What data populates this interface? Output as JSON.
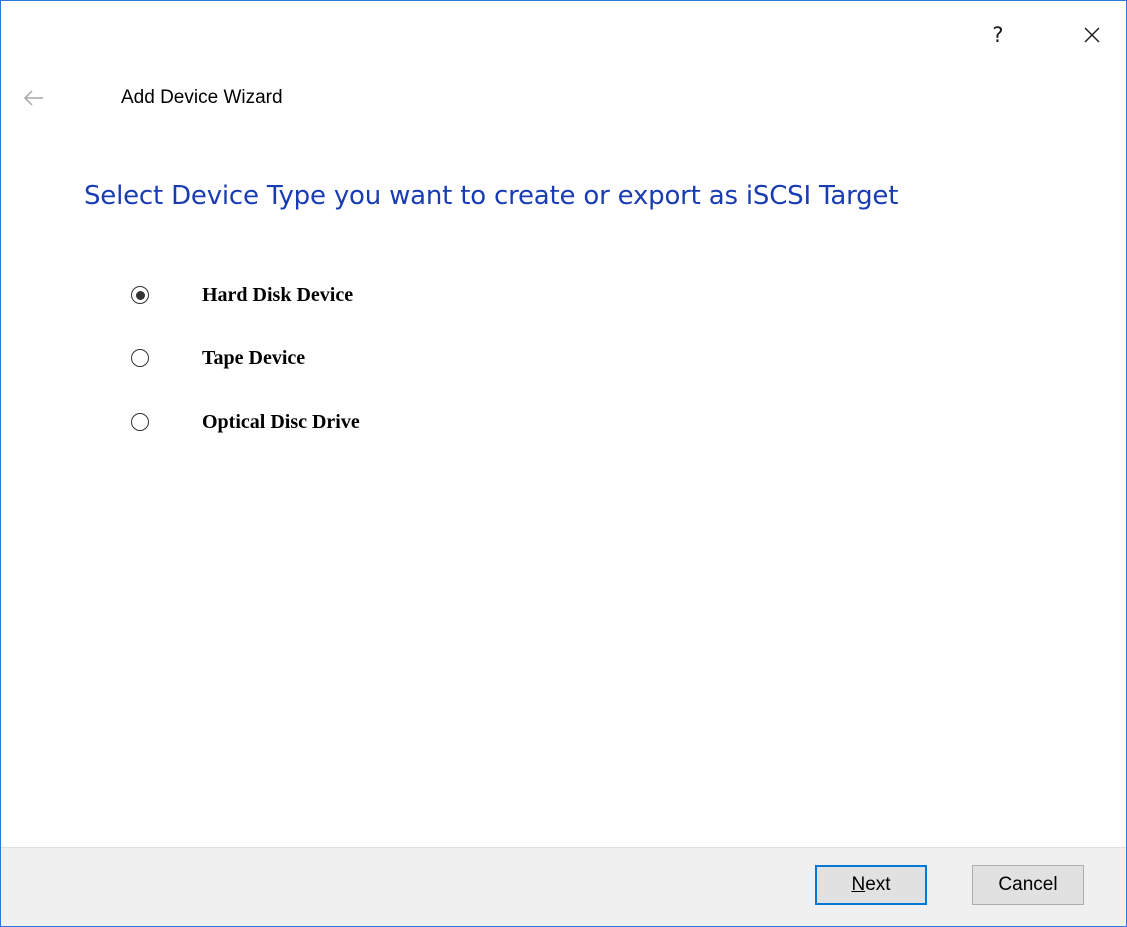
{
  "window": {
    "help_label": "?",
    "close_icon": "close-icon",
    "accent_color": "#2b79d8"
  },
  "header": {
    "back_icon": "back-arrow-icon",
    "title": "Add Device Wizard"
  },
  "main": {
    "heading": "Select Device Type you want to create or export as iSCSI Target",
    "heading_color": "#1a3cb3",
    "options": [
      {
        "label": "Hard Disk Device",
        "selected": true
      },
      {
        "label": "Tape Device",
        "selected": false
      },
      {
        "label": "Optical Disc Drive",
        "selected": false
      }
    ]
  },
  "footer": {
    "next_mnemonic": "N",
    "next_rest": "ext",
    "cancel_label": "Cancel"
  }
}
